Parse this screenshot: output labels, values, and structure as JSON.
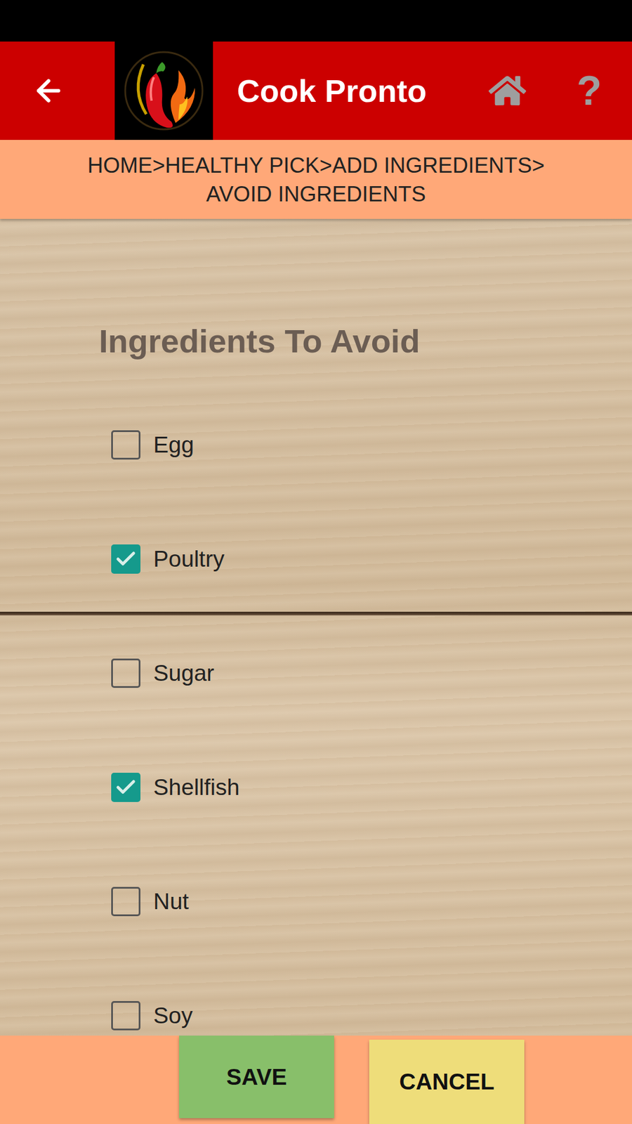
{
  "app": {
    "title": "Cook Pronto",
    "help": "?"
  },
  "breadcrumb": {
    "items": [
      "HOME",
      "HEALTHY PICK",
      "ADD INGREDIENTS",
      "AVOID INGREDIENTS"
    ],
    "separator": ">"
  },
  "section": {
    "title": "Ingredients To Avoid"
  },
  "ingredients": [
    {
      "label": "Egg",
      "checked": false
    },
    {
      "label": "Poultry",
      "checked": true
    },
    {
      "label": "Sugar",
      "checked": false
    },
    {
      "label": "Shellfish",
      "checked": true
    },
    {
      "label": "Nut",
      "checked": false
    },
    {
      "label": "Soy",
      "checked": false
    }
  ],
  "buttons": [
    {
      "label": "SAVE",
      "kind": "save"
    },
    {
      "label": "CANCEL",
      "kind": "cancel"
    }
  ]
}
